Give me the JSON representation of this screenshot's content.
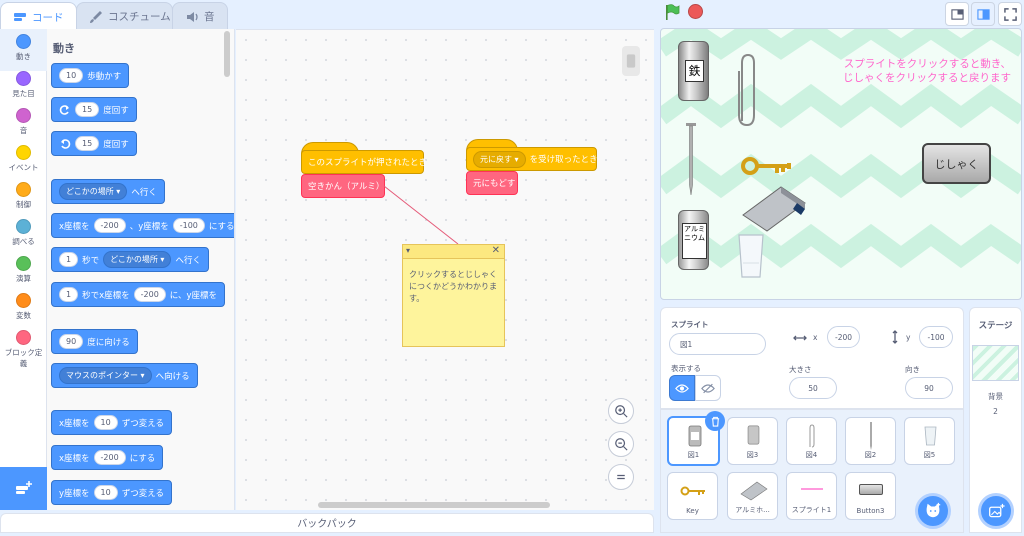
{
  "tabs": [
    {
      "label": "コード"
    },
    {
      "label": "コスチューム"
    },
    {
      "label": "音"
    }
  ],
  "categories": [
    {
      "label": "動き",
      "color": "#4c97ff"
    },
    {
      "label": "見た目",
      "color": "#9966ff"
    },
    {
      "label": "音",
      "color": "#cf63cf"
    },
    {
      "label": "イベント",
      "color": "#ffd500"
    },
    {
      "label": "制御",
      "color": "#ffab19"
    },
    {
      "label": "調べる",
      "color": "#5cb1d6"
    },
    {
      "label": "演算",
      "color": "#59c059"
    },
    {
      "label": "変数",
      "color": "#ff8c1a"
    },
    {
      "label": "ブロック定義",
      "color": "#ff6680"
    }
  ],
  "palette": {
    "title": "動き",
    "b1": {
      "v": "10",
      "t": "歩動かす"
    },
    "b2": {
      "v": "15",
      "t": "度回す"
    },
    "b3": {
      "v": "15",
      "t": "度回す"
    },
    "b4": {
      "dd": "どこかの場所",
      "t": "へ行く"
    },
    "b5": {
      "a": "x座標を",
      "x": "-200",
      "b": "、y座標を",
      "y": "-100",
      "c": "にする"
    },
    "b6": {
      "v": "1",
      "a": "秒で",
      "dd": "どこかの場所",
      "t": "へ行く"
    },
    "b7": {
      "v": "1",
      "a": "秒でx座標を",
      "x": "-200",
      "b": "に、y座標を"
    },
    "b8": {
      "v": "90",
      "t": "度に向ける"
    },
    "b9": {
      "dd": "マウスのポインター",
      "t": "へ向ける"
    },
    "b10": {
      "a": "x座標を",
      "v": "10",
      "t": "ずつ変える"
    },
    "b11": {
      "a": "x座標を",
      "v": "-200",
      "t": "にする"
    },
    "b12": {
      "a": "y座標を",
      "v": "10",
      "t": "ずつ変える"
    }
  },
  "workspace": {
    "script1": {
      "hat": "このスプライトが押されたとき",
      "block": "空きかん（アルミ）"
    },
    "script2": {
      "dd": "元に戻す",
      "hat": "を受け取ったとき",
      "block": "元にもどす"
    },
    "note": "クリックするとじしゃくにつくかどうかわかります。"
  },
  "backpack": "バックパック",
  "stage": {
    "message_line1": "スプライトをクリックすると動き、",
    "message_line2": "じしゃくをクリックすると戻ります",
    "button": "じしゃく",
    "can1_label": "鉄",
    "can2_label": "アルミニウム",
    "bg_color": "#f2fdf7",
    "zigzag_color": "#ccf2e0"
  },
  "sprite_info": {
    "sprite_label": "スプライト",
    "name": "図1",
    "x_label": "x",
    "x": "-200",
    "y_label": "y",
    "y": "-100",
    "show_label": "表示する",
    "size_label": "大きさ",
    "size": "50",
    "dir_label": "向き",
    "direction": "90"
  },
  "sprites": [
    {
      "name": "図1"
    },
    {
      "name": "図3"
    },
    {
      "name": "図4"
    },
    {
      "name": "図2"
    },
    {
      "name": "図5"
    },
    {
      "name": "Key"
    },
    {
      "name": "アルミホ..."
    },
    {
      "name": "スプライト1"
    },
    {
      "name": "Button3"
    }
  ],
  "stage_panel": {
    "title": "ステージ",
    "bg_label": "背景",
    "bg_count": "2"
  },
  "colors": {
    "motion": "#4c97ff",
    "events": "#ffbf00",
    "myblocks": "#ff6680",
    "accent": "#4c97ff"
  }
}
